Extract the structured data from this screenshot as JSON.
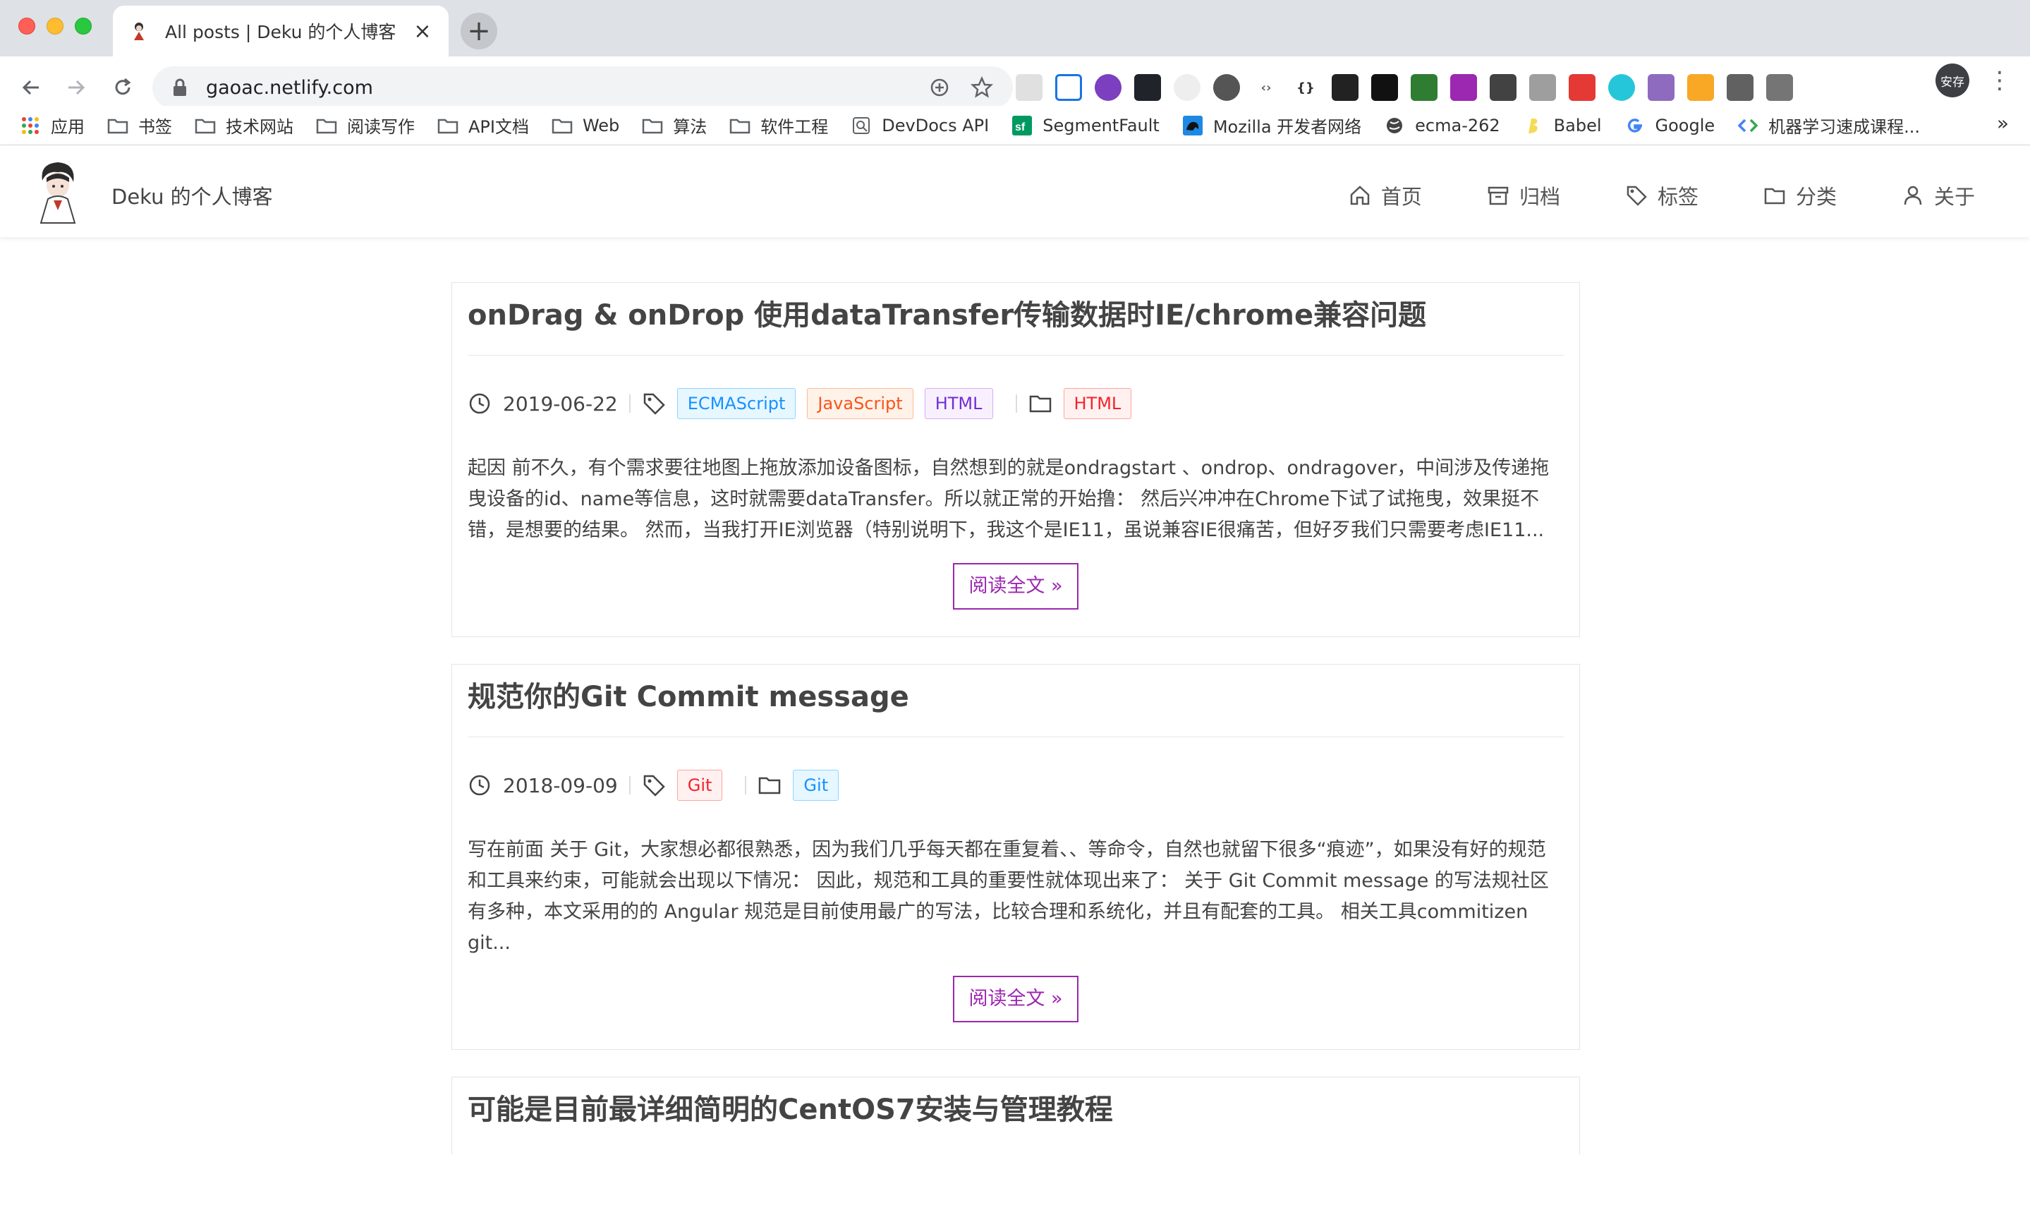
{
  "browser": {
    "tab_title": "All posts | Deku 的个人博客",
    "tab_close": "×",
    "new_tab": "+",
    "url": "gaoac.netlify.com",
    "profile_label": "安存",
    "bookmarks_more": "»",
    "bookmarks": [
      {
        "label": "应用",
        "icon": "apps-grid-icon"
      },
      {
        "label": "书签",
        "icon": "folder-icon"
      },
      {
        "label": "技术网站",
        "icon": "folder-icon"
      },
      {
        "label": "阅读写作",
        "icon": "folder-icon"
      },
      {
        "label": "API文档",
        "icon": "folder-icon"
      },
      {
        "label": "Web",
        "icon": "folder-icon"
      },
      {
        "label": "算法",
        "icon": "folder-icon"
      },
      {
        "label": "软件工程",
        "icon": "folder-icon"
      },
      {
        "label": "DevDocs API",
        "icon": "devdocs-icon"
      },
      {
        "label": "SegmentFault",
        "icon": "segmentfault-icon"
      },
      {
        "label": "Mozilla 开发者网络",
        "icon": "mdn-icon"
      },
      {
        "label": "ecma-262",
        "icon": "globe-icon"
      },
      {
        "label": "Babel",
        "icon": "babel-icon"
      },
      {
        "label": "Google",
        "icon": "google-icon"
      },
      {
        "label": "机器学习速成课程...",
        "icon": "ml-course-icon"
      }
    ]
  },
  "site": {
    "title": "Deku 的个人博客",
    "nav": [
      {
        "label": "首页",
        "icon": "home-icon"
      },
      {
        "label": "归档",
        "icon": "archive-icon"
      },
      {
        "label": "标签",
        "icon": "tag-icon"
      },
      {
        "label": "分类",
        "icon": "folder-icon"
      },
      {
        "label": "关于",
        "icon": "user-icon"
      }
    ]
  },
  "posts": [
    {
      "title": "onDrag & onDrop 使用dataTransfer传输数据时IE/chrome兼容问题",
      "date": "2019-06-22",
      "tags": [
        "ECMAScript",
        "JavaScript",
        "HTML"
      ],
      "category": "HTML",
      "excerpt": "起因 前不久，有个需求要往地图上拖放添加设备图标，自然想到的就是ondragstart 、ondrop、ondragover，中间涉及传递拖曳设备的id、name等信息，这时就需要dataTransfer。所以就正常的开始撸： 然后兴冲冲在Chrome下试了试拖曳，效果挺不错，是想要的结果。 然而，当我打开IE浏览器（特别说明下，我这个是IE11，虽说兼容IE很痛苦，但好歹我们只需要考虑IE11...",
      "read_more": "阅读全文 »"
    },
    {
      "title": "规范你的Git Commit message",
      "date": "2018-09-09",
      "tags": [
        "Git"
      ],
      "category": "Git",
      "excerpt": "写在前面 关于 Git，大家想必都很熟悉，因为我们几乎每天都在重复着、、等命令，自然也就留下很多“痕迹”，如果没有好的规范和工具来约束，可能就会出现以下情况： 因此，规范和工具的重要性就体现出来了： 关于 Git Commit message 的写法规社区有多种，本文采用的的 Angular 规范是目前使用最广的写法，比较合理和系统化，并且有配套的工具。 相关工具commitizen git...",
      "read_more": "阅读全文 »"
    },
    {
      "title": "可能是目前最详细简明的CentOS7安装与管理教程"
    }
  ]
}
